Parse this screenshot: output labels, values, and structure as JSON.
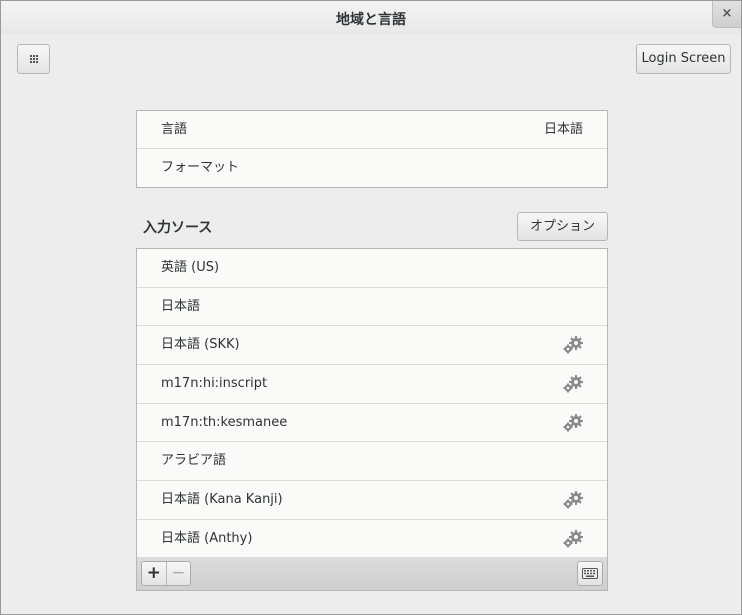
{
  "window": {
    "title": "地域と言語",
    "close_label": "×"
  },
  "header": {
    "login_screen_label": "Login Screen"
  },
  "language_section": {
    "rows": [
      {
        "label": "言語",
        "value": "日本語"
      },
      {
        "label": "フォーマット",
        "value": ""
      }
    ]
  },
  "input_sources": {
    "title": "入力ソース",
    "options_label": "オプション",
    "items": [
      {
        "label": "英語 (US)",
        "has_settings": false
      },
      {
        "label": "日本語",
        "has_settings": false
      },
      {
        "label": "日本語 (SKK)",
        "has_settings": true
      },
      {
        "label": "m17n:hi:inscript",
        "has_settings": true
      },
      {
        "label": "m17n:th:kesmanee",
        "has_settings": true
      },
      {
        "label": "アラビア語",
        "has_settings": false
      },
      {
        "label": "日本語 (Kana Kanji)",
        "has_settings": true
      },
      {
        "label": "日本語 (Anthy)",
        "has_settings": true
      }
    ],
    "toolbar": {
      "add_label": "+",
      "remove_label": "−"
    }
  }
}
